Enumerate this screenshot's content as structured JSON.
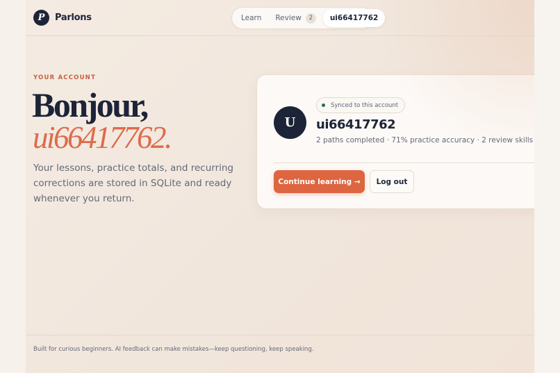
{
  "brand": {
    "logo_letter": "P",
    "name": "Parlons"
  },
  "nav": {
    "learn": "Learn",
    "review": "Review",
    "review_count": "2",
    "account": "ui66417762"
  },
  "hero": {
    "eyebrow": "YOUR ACCOUNT",
    "greeting": "Bonjour,",
    "username": "ui66417762.",
    "intro": "Your lessons, practice totals, and recurring corrections are stored in SQLite and ready whenever you return."
  },
  "card": {
    "avatar_letter": "U",
    "synced_label": "Synced to this account",
    "username": "ui66417762",
    "stats": "2 paths completed · 71% practice accuracy · 2 review skills",
    "continue_label": "Continue learning →",
    "logout_label": "Log out"
  },
  "footer": {
    "text": "Built for curious beginners. AI feedback can make mistakes—keep questioning, keep speaking."
  },
  "colors": {
    "navy": "#1d2438",
    "accent": "#dd6540",
    "sync_dot": "#2c6a55"
  }
}
